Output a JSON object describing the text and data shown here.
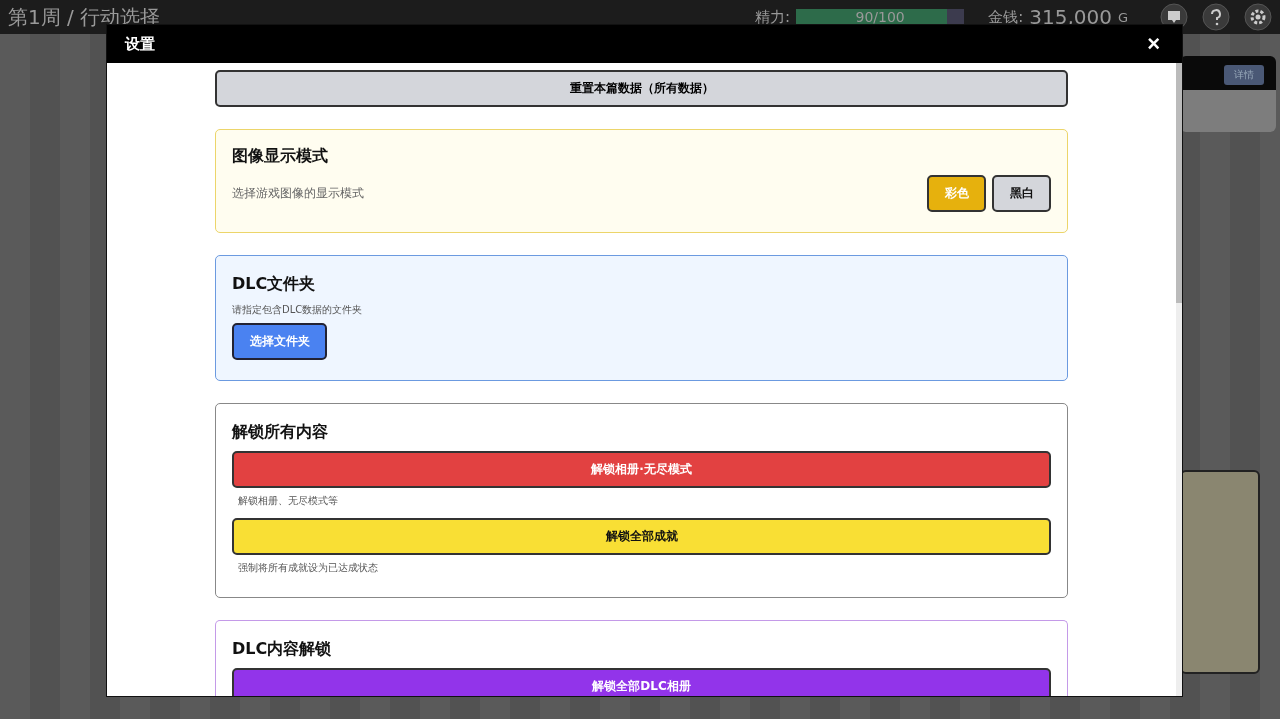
{
  "hud": {
    "title": "第1周 / 行动选择",
    "stamina_label": "精力:",
    "stamina": {
      "level": 0.9,
      "reading": "90/100"
    },
    "money_label": "金钱:",
    "money": "315,000",
    "money_unit": "G",
    "side_button": "详情"
  },
  "dialog": {
    "title": "设置",
    "close": "×",
    "reset_button": "重置本篇数据（所有数据）",
    "sections": [
      {
        "kind": "mode",
        "color": "#fffdf0",
        "title": "图像显示模式",
        "desc": "选择游戏图像的显示模式",
        "options": [
          {
            "label": "彩色",
            "selected": true
          },
          {
            "label": "黑白",
            "selected": false
          }
        ]
      },
      {
        "kind": "folder",
        "color": "#eff6ff",
        "title": "DLC文件夹",
        "desc": "请指定包含DLC数据的文件夹",
        "button": "选择文件夹"
      },
      {
        "kind": "unlock",
        "color": "#ffffff",
        "title": "解锁所有内容",
        "actions": [
          {
            "label": "解锁相册·无尽模式",
            "color": "#e24141",
            "note": "解锁相册、无尽模式等"
          },
          {
            "label": "解锁全部成就",
            "color": "#f9df34",
            "note": "强制将所有成就设为已达成状态"
          }
        ]
      },
      {
        "kind": "unlock",
        "color": "#ffffff",
        "title": "DLC内容解锁",
        "actions": [
          {
            "label": "解锁全部DLC相册",
            "color": "#9234ea"
          }
        ]
      }
    ]
  }
}
